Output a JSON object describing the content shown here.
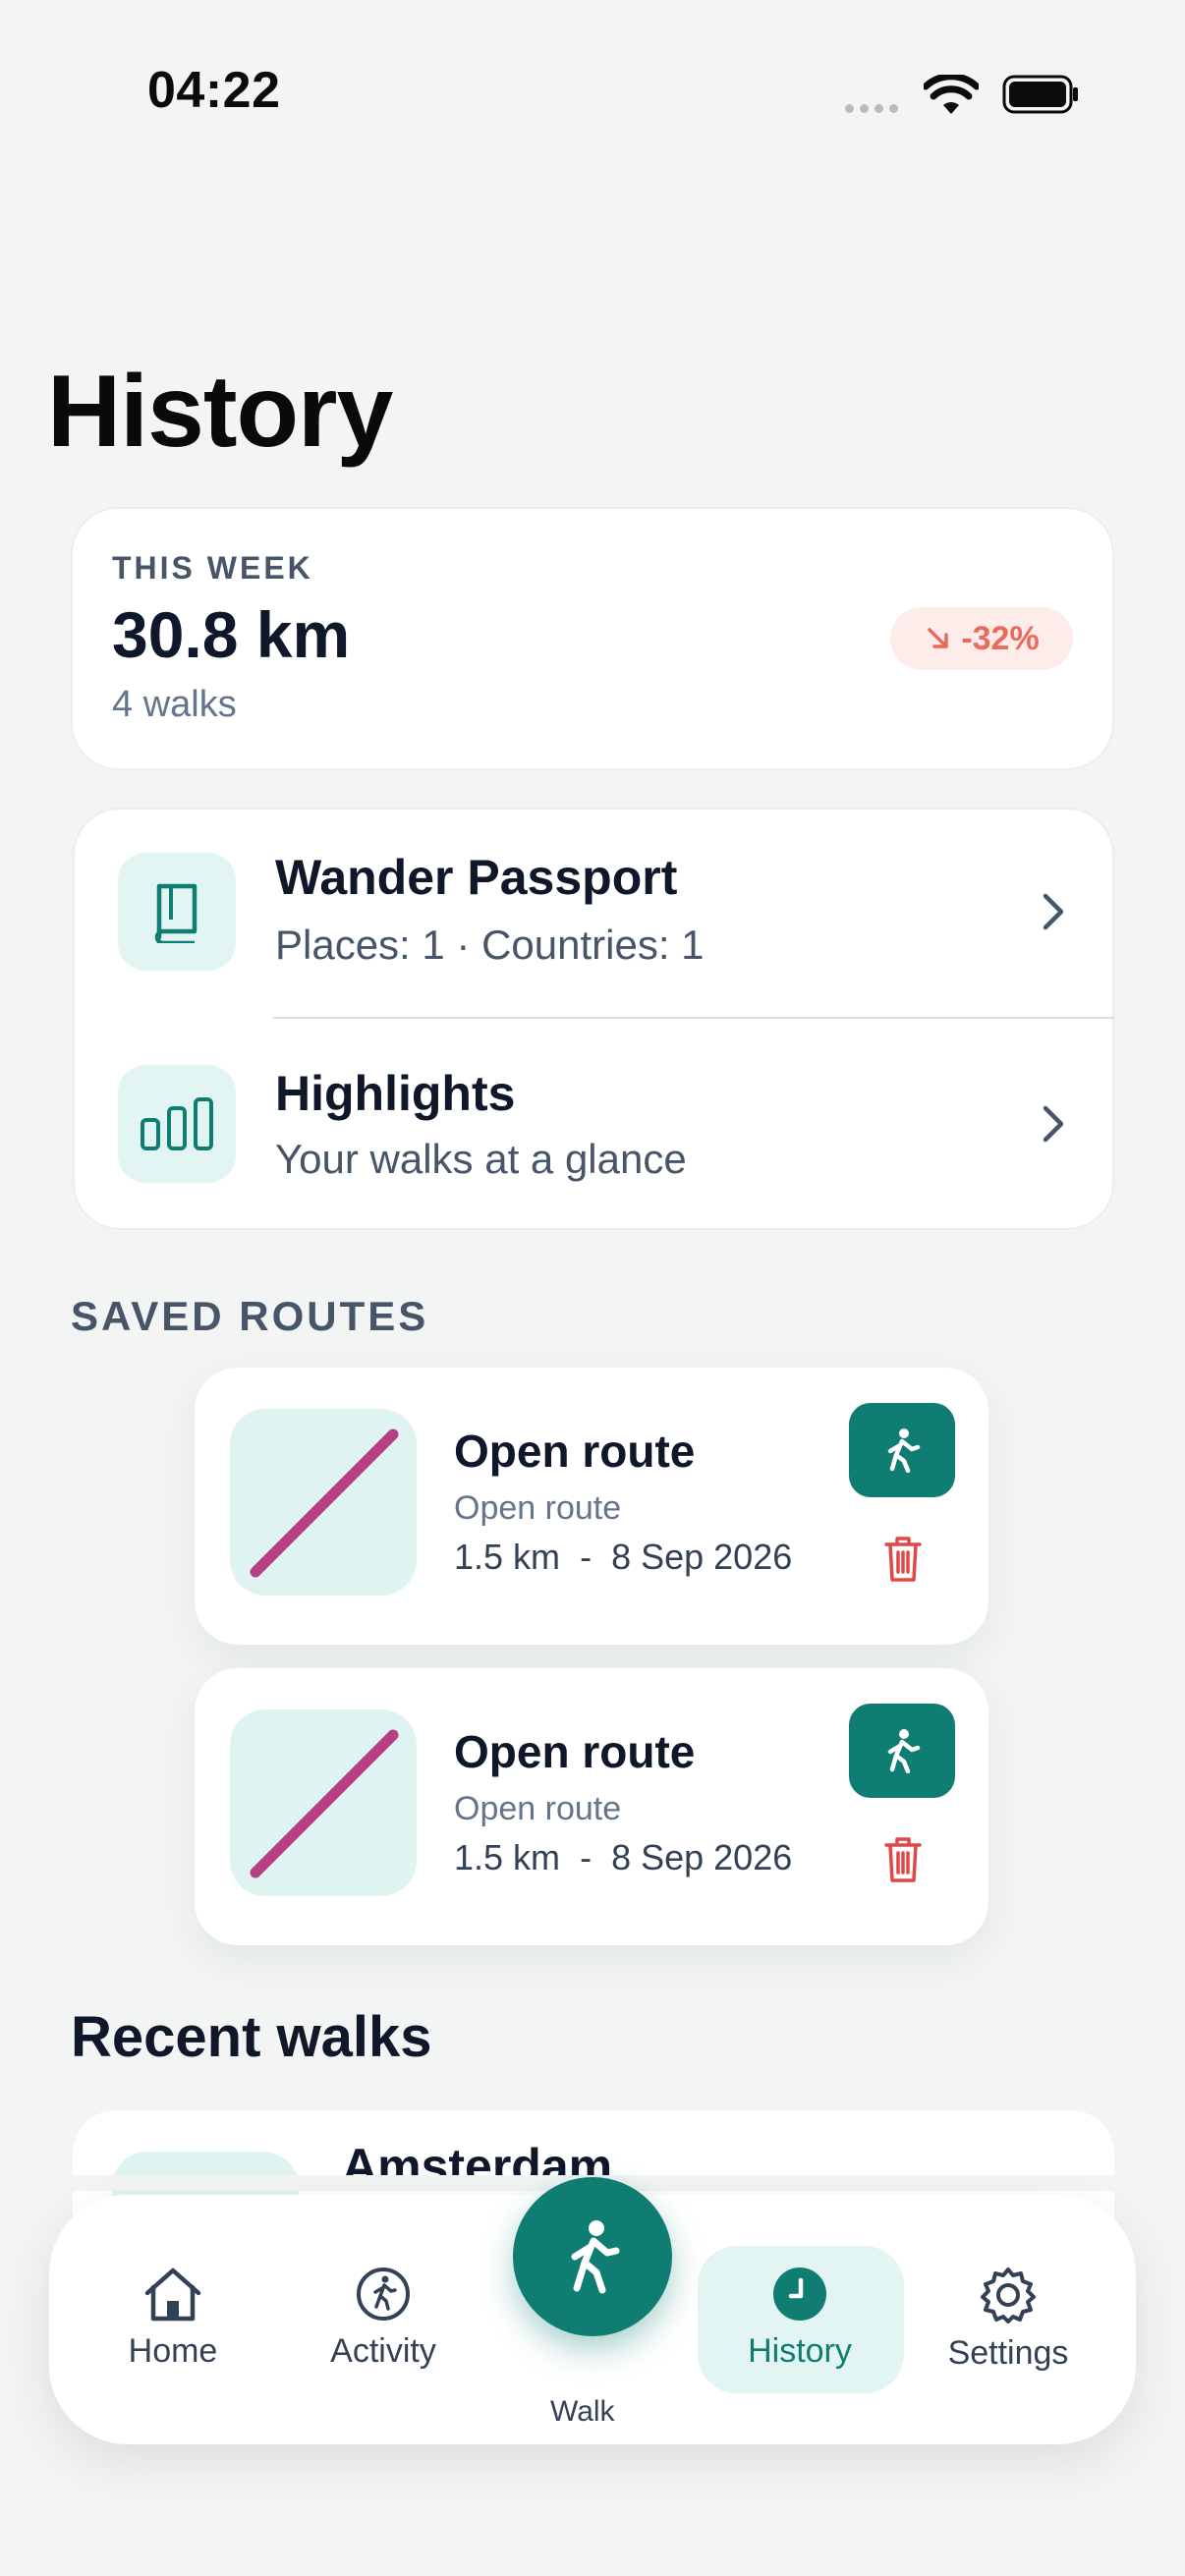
{
  "status_bar": {
    "time": "04:22"
  },
  "page": {
    "title": "History"
  },
  "week": {
    "label": "THIS WEEK",
    "distance": "30.8 km",
    "walks": "4 walks",
    "trend": "-32%"
  },
  "links": [
    {
      "title": "Wander Passport",
      "subtitle": "Places: 1 · Countries: 1",
      "icon": "book-icon"
    },
    {
      "title": "Highlights",
      "subtitle": "Your walks at a glance",
      "icon": "bar-chart-icon"
    }
  ],
  "saved_routes": {
    "label": "SAVED ROUTES",
    "items": [
      {
        "title": "Open route",
        "subtitle": "Open route",
        "distance": "1.5 km",
        "separator": "-",
        "date": "8 Sep 2026"
      },
      {
        "title": "Open route",
        "subtitle": "Open route",
        "distance": "1.5 km",
        "separator": "-",
        "date": "8 Sep 2026"
      }
    ]
  },
  "recent": {
    "title": "Recent walks",
    "items": [
      {
        "name": "Amsterdam"
      }
    ]
  },
  "tabs": [
    {
      "label": "Home",
      "icon": "home-icon"
    },
    {
      "label": "Activity",
      "icon": "activity-icon"
    },
    {
      "label": "Walk",
      "icon": "walk-icon"
    },
    {
      "label": "History",
      "icon": "history-icon",
      "active": true
    },
    {
      "label": "Settings",
      "icon": "gear-icon"
    }
  ],
  "colors": {
    "accent": "#0f7d72",
    "accent_light": "#e2f5f2",
    "route_line": "#b83f86",
    "danger": "#e04848",
    "trend_down": "#ea6a5c"
  }
}
